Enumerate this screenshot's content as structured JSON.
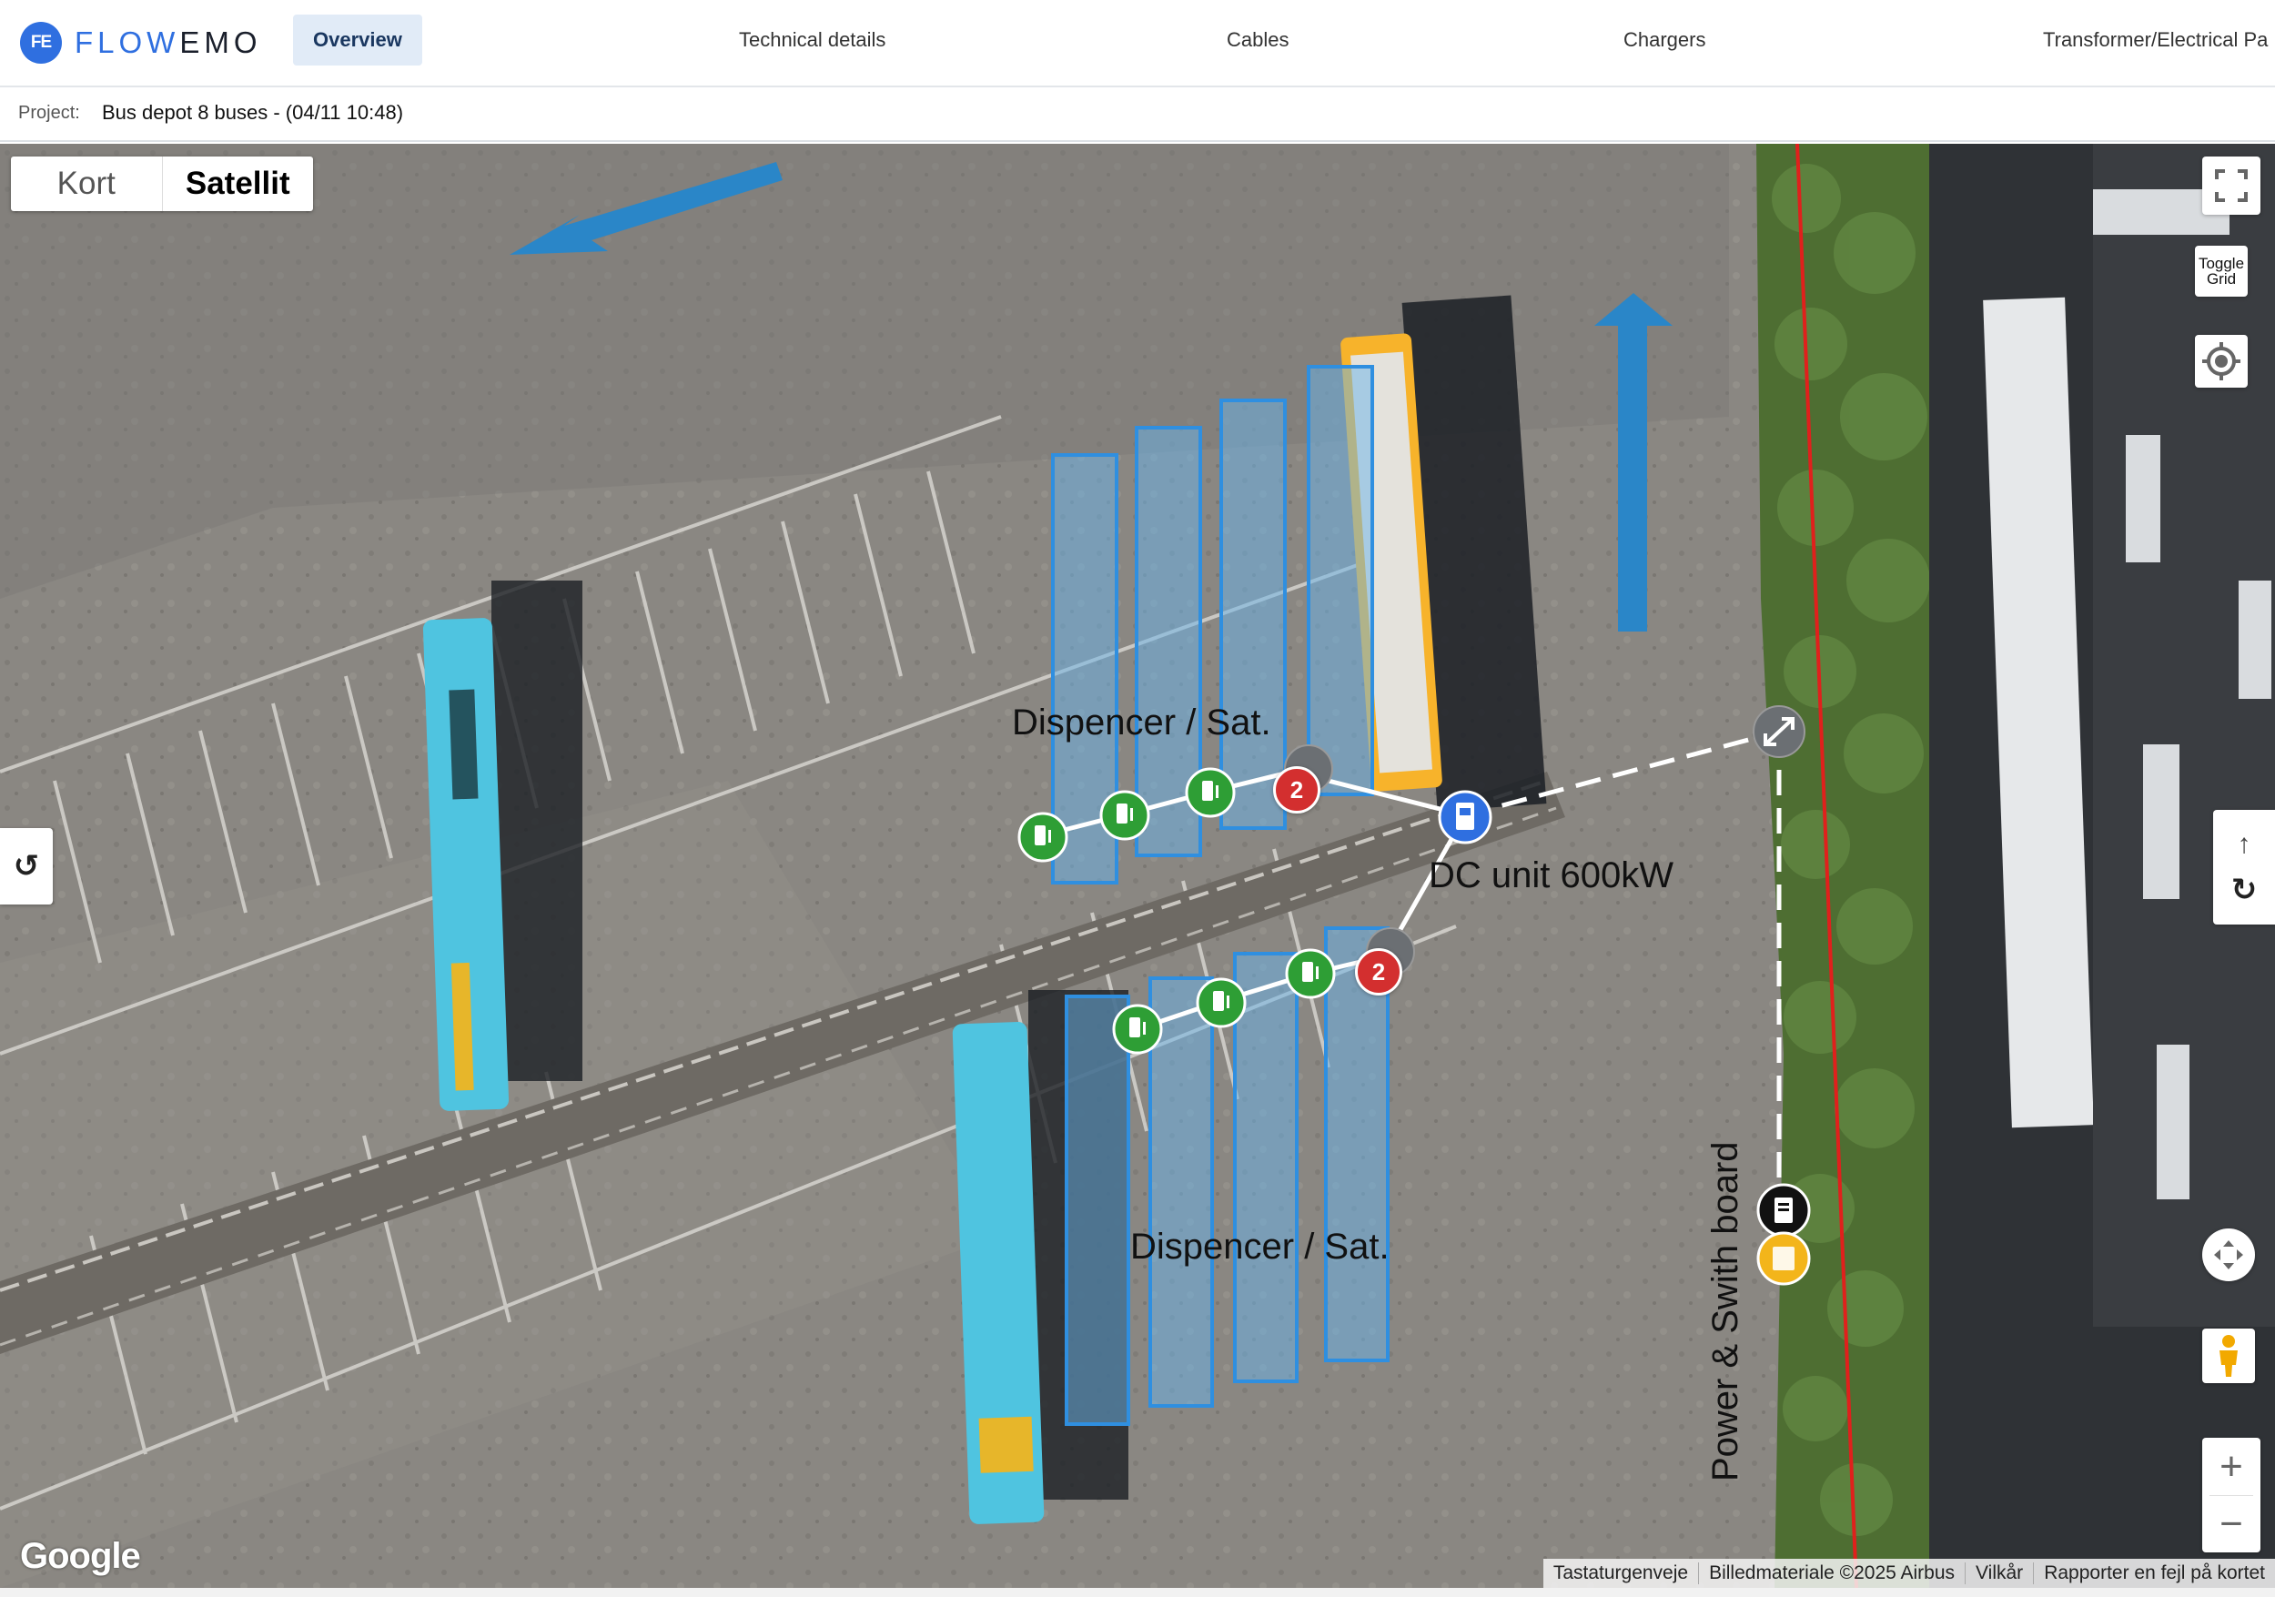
{
  "brand": {
    "badge": "FE",
    "name_part1": "FLOW",
    "name_part2": "EMO"
  },
  "nav": {
    "tabs": [
      {
        "label": "Overview",
        "active": true
      },
      {
        "label": "Technical details"
      },
      {
        "label": "Cables"
      },
      {
        "label": "Chargers"
      },
      {
        "label": "Transformer/Electrical Pa"
      }
    ]
  },
  "project": {
    "label": "Project:",
    "value": "Bus depot 8 buses - (04/11 10:48)"
  },
  "map": {
    "type_toggle": {
      "map": "Kort",
      "satellite": "Satellit",
      "selected": "Satellit"
    },
    "labels": {
      "dispenser_top": "Dispencer / Sat.",
      "dispenser_bottom": "Dispencer / Sat.",
      "dc_unit": "DC unit 600kW",
      "power_board": "Power & Swith board"
    },
    "markers": {
      "group_count_top": "2",
      "group_count_bottom": "2"
    },
    "controls": {
      "toggle_grid": "Toggle Grid",
      "zoom_in": "+",
      "zoom_out": "−",
      "tilt_up": "↑",
      "rotate_ccw": "↺",
      "rotate_cw": "↻"
    },
    "google_logo": "Google",
    "attribution": [
      "Tastaturgenveje",
      "Billedmateriale ©2025 Airbus",
      "Vilkår",
      "Rapporter en fejl på kortet"
    ],
    "colors": {
      "charger": "#2e9e35",
      "group_badge": "#d32f2f",
      "dc_unit": "#2f6fe0",
      "bay_fill": "#6ab4ea",
      "bay_stroke": "#2f8fe0",
      "direction_arrow": "#2a86c8",
      "property_line": "#e0201c",
      "power_board": "#111111",
      "transformer": "#f3b51b"
    }
  }
}
